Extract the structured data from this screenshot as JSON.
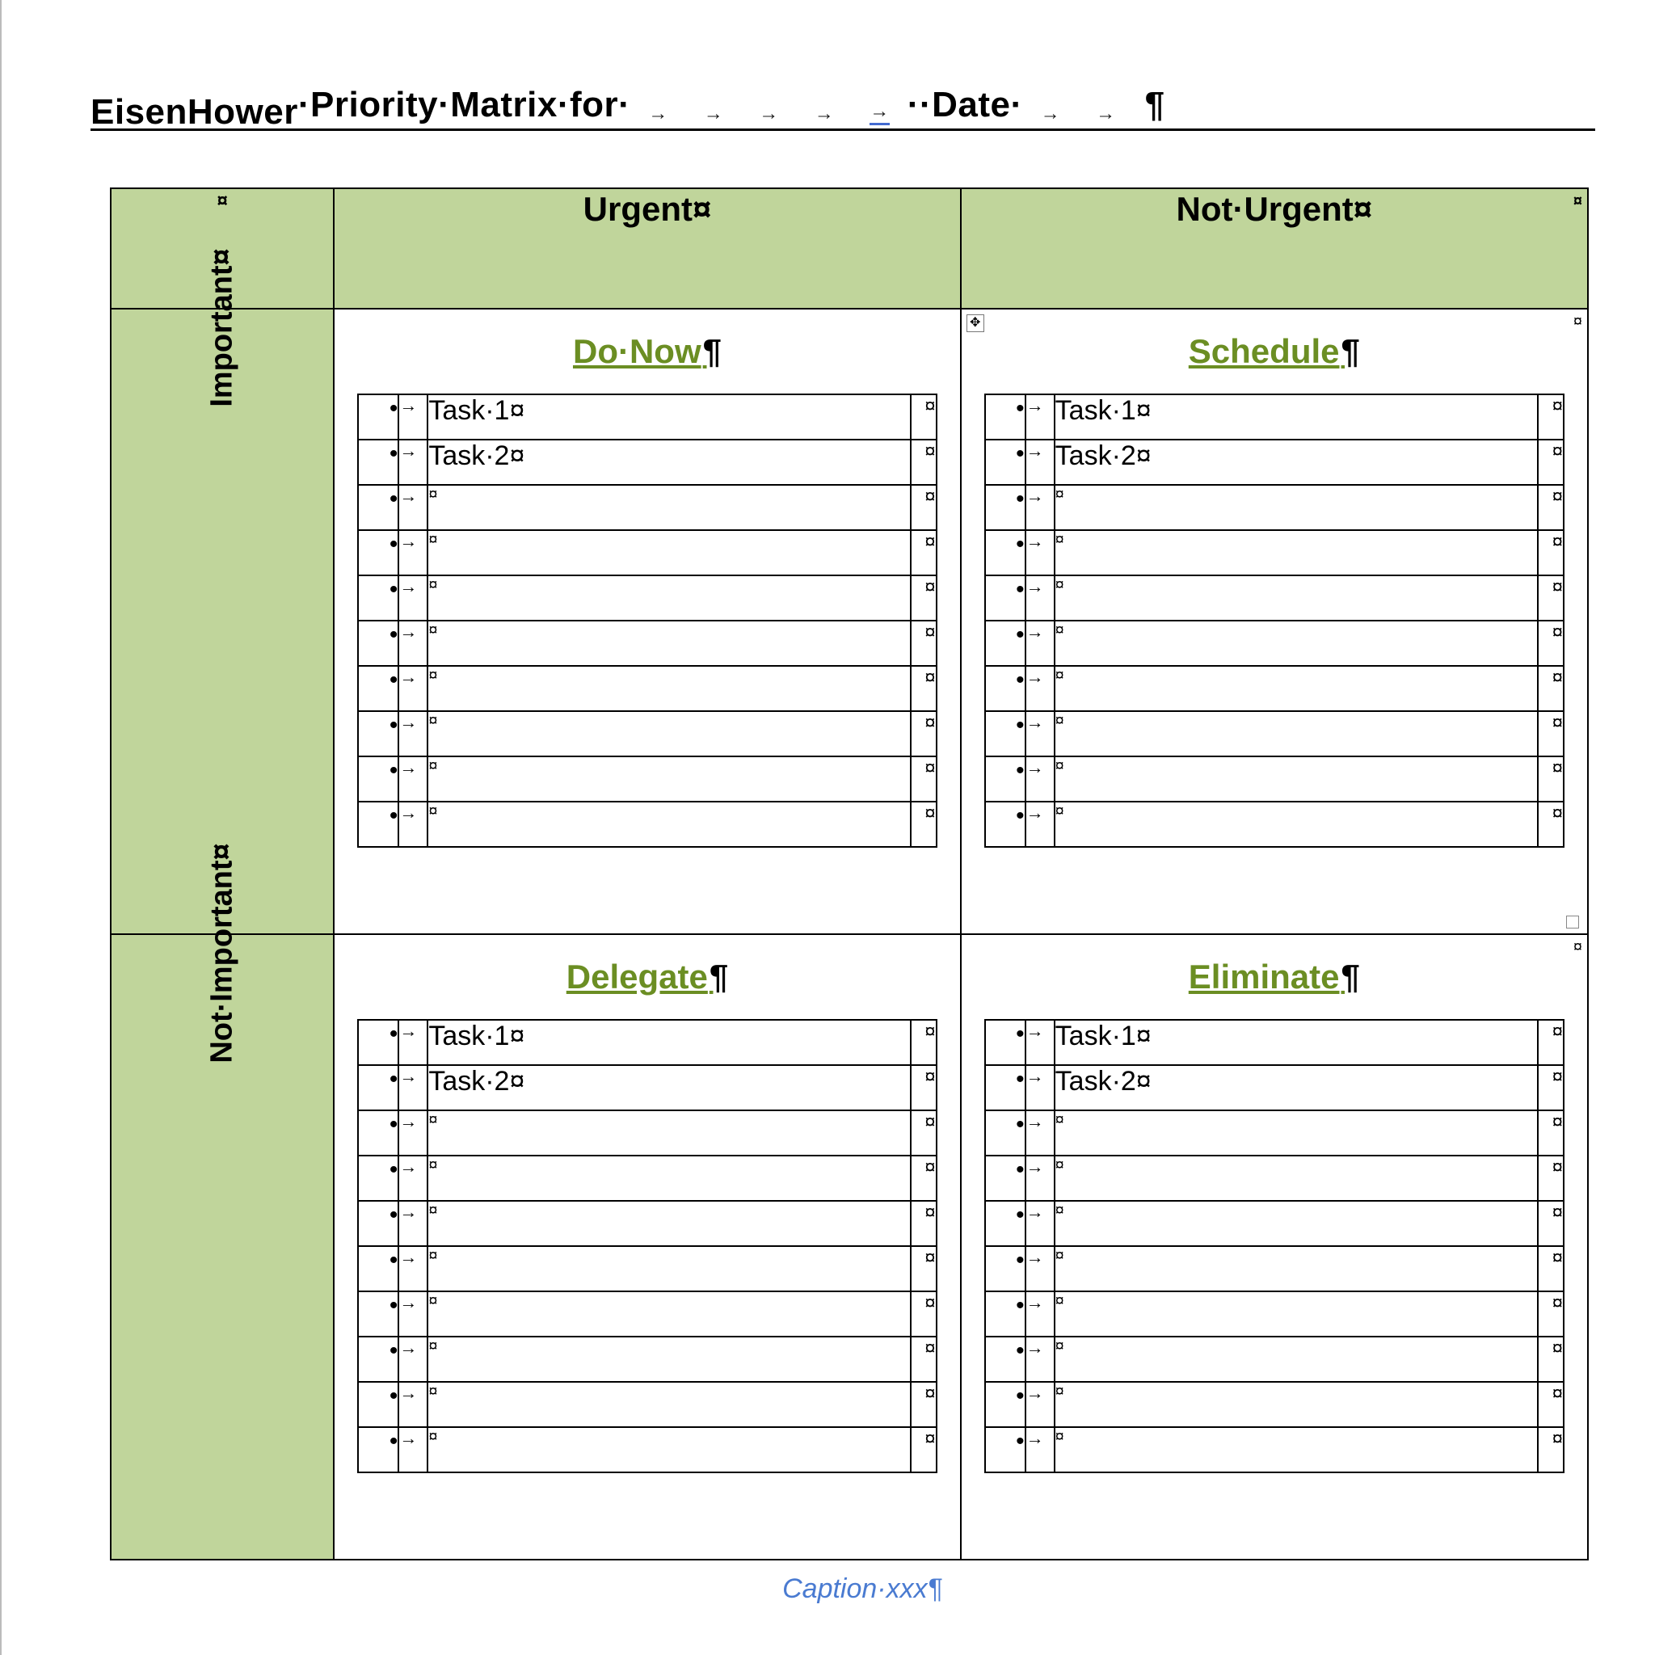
{
  "marks": {
    "cell": "¤",
    "pilcrow": "¶",
    "bullet": "•",
    "tab": "→",
    "dot": "·",
    "ddot": "··"
  },
  "title": {
    "word1": "EisenHower",
    "rest": "Priority·Matrix·for·",
    "date_label": "Date"
  },
  "columns": {
    "urgent": "Urgent",
    "not_urgent": "Not·Urgent"
  },
  "rows": {
    "important": "Important",
    "not_important": "Not·Important"
  },
  "quadrants": {
    "do_now": {
      "title": "Do·Now",
      "tasks": [
        "Task·1",
        "Task·2",
        "",
        "",
        "",
        "",
        "",
        "",
        "",
        ""
      ]
    },
    "schedule": {
      "title": "Schedule",
      "tasks": [
        "Task·1",
        "Task·2",
        "",
        "",
        "",
        "",
        "",
        "",
        "",
        ""
      ]
    },
    "delegate": {
      "title": "Delegate",
      "tasks": [
        "Task·1",
        "Task·2",
        "",
        "",
        "",
        "",
        "",
        "",
        "",
        ""
      ]
    },
    "eliminate": {
      "title": "Eliminate",
      "tasks": [
        "Task·1",
        "Task·2",
        "",
        "",
        "",
        "",
        "",
        "",
        "",
        ""
      ]
    }
  },
  "caption": "Caption·xxx"
}
